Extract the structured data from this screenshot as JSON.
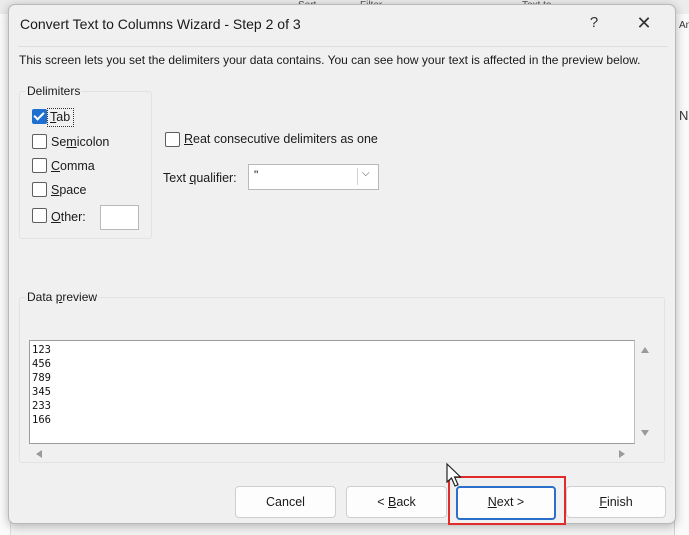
{
  "background": {
    "top_fragments": [
      "Filter",
      "Sort",
      "Text to"
    ],
    "right_fragments": [
      "Analy",
      "N"
    ]
  },
  "dialog": {
    "title": "Convert Text to Columns Wizard - Step 2 of 3",
    "help_icon": "?",
    "close_icon": "✕",
    "instruction": "This screen lets you set the delimiters your data contains.  You can see how your text is affected in the preview below."
  },
  "delimiters": {
    "group_label": "Delimiters",
    "options": [
      {
        "pre": "",
        "key": "T",
        "post": "ab",
        "checked": true
      },
      {
        "pre": "Se",
        "key": "m",
        "post": "icolon",
        "checked": false
      },
      {
        "pre": "",
        "key": "C",
        "post": "omma",
        "checked": false
      },
      {
        "pre": "",
        "key": "S",
        "post": "pace",
        "checked": false
      },
      {
        "pre": "",
        "key": "O",
        "post": "ther:",
        "checked": false
      }
    ],
    "other_value": ""
  },
  "consecutive": {
    "pre": "",
    "key": "R",
    "post": "eat consecutive delimiters as one",
    "checked": false
  },
  "text_qualifier": {
    "label_pre": "Text ",
    "label_key": "q",
    "label_post": "ualifier:",
    "value": "\"",
    "chevron": "⌵"
  },
  "preview": {
    "label_pre": "Data ",
    "label_key": "p",
    "label_post": "review",
    "lines": [
      "123",
      "456",
      "789",
      "345",
      "233",
      "166"
    ]
  },
  "buttons": {
    "cancel": {
      "pre": "Cancel",
      "key": "",
      "post": ""
    },
    "back": {
      "pre": "< ",
      "key": "B",
      "post": "ack"
    },
    "next": {
      "pre": "",
      "key": "N",
      "post": "ext >"
    },
    "finish": {
      "pre": "",
      "key": "F",
      "post": "inish"
    }
  },
  "colors": {
    "accent": "#1f6fd1",
    "highlight": "#e02b2b",
    "dialog_bg": "#f0f0f0"
  }
}
